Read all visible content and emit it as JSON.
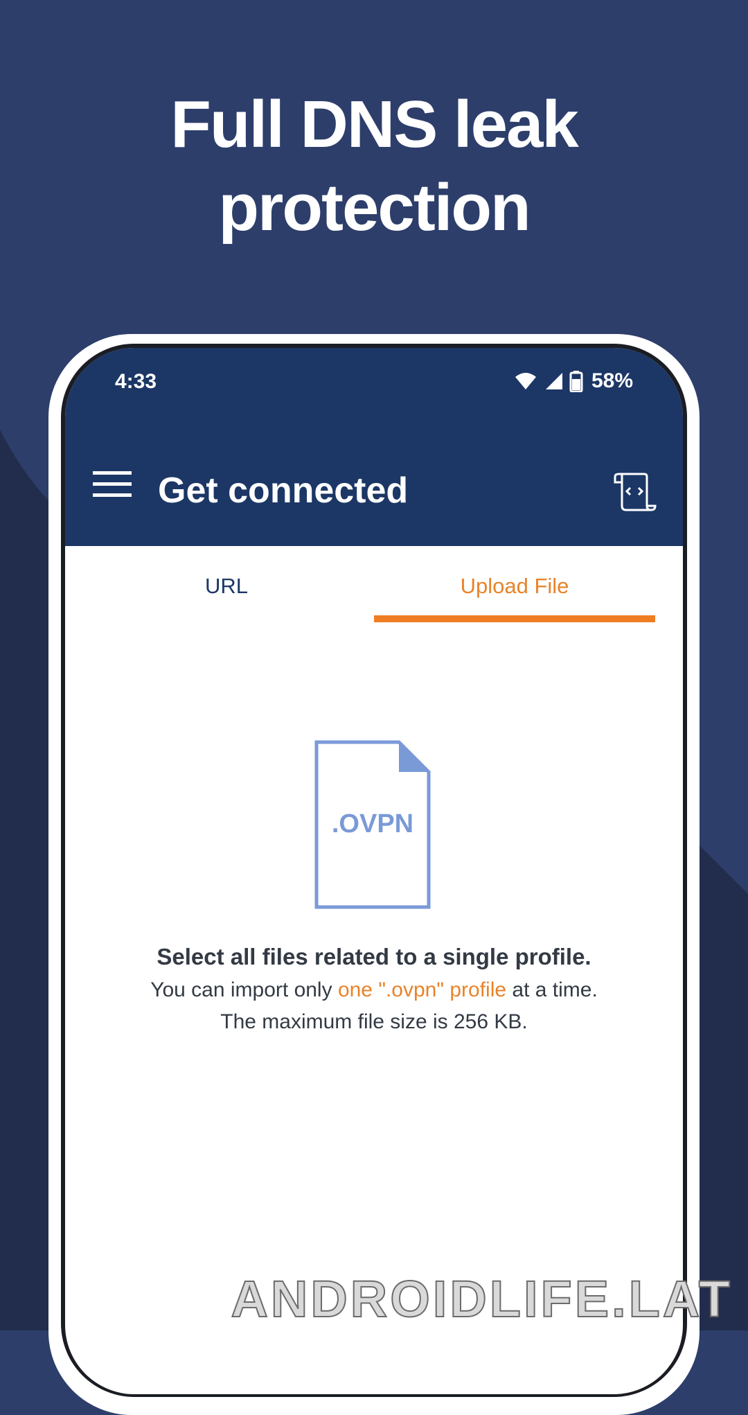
{
  "headline": {
    "line1": "Full DNS leak",
    "line2": "protection"
  },
  "status_bar": {
    "time": "4:33",
    "battery": "58%",
    "icons": [
      "wifi-icon",
      "signal-icon",
      "battery-icon"
    ]
  },
  "app_bar": {
    "title": "Get connected",
    "left_icon": "menu-icon",
    "right_icon": "log-icon"
  },
  "tabs": [
    {
      "label": "URL",
      "selected": false
    },
    {
      "label": "Upload File",
      "selected": true
    }
  ],
  "upload": {
    "file_icon_label": ".OVPN",
    "heading": "Select all files related to a single profile.",
    "line1_before": "You can import only ",
    "line1_highlight": "one \".ovpn\" profile",
    "line1_after": " at a time.",
    "line2": "The maximum file size is 256 KB."
  },
  "watermark": "ANDROIDLIFE.LAT",
  "colors": {
    "background": "#2d3e6b",
    "app_bar": "#1c3766",
    "accent": "#ef7d22",
    "file_icon": "#7a9ad7"
  }
}
